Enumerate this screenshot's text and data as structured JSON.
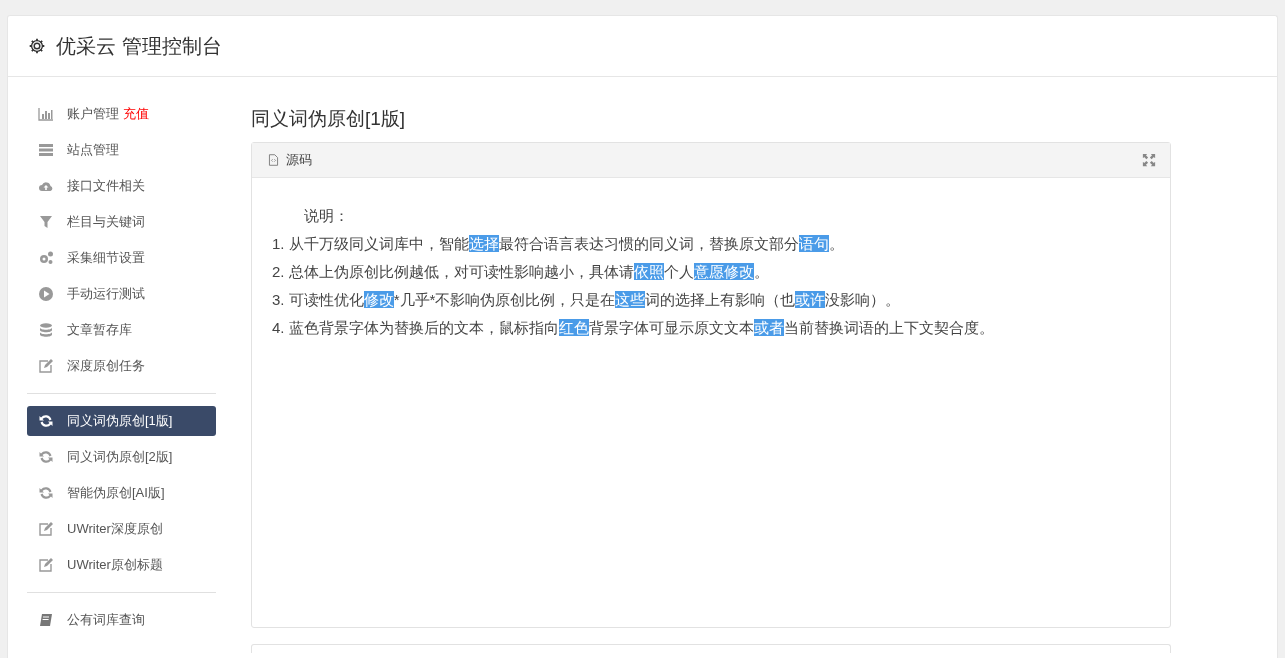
{
  "header": {
    "title": "优采云 管理控制台"
  },
  "sidebar": {
    "groups": [
      {
        "items": [
          {
            "kind": "chart",
            "label": "账户管理",
            "badge": "充值",
            "selected": false
          },
          {
            "kind": "server",
            "label": "站点管理",
            "selected": false
          },
          {
            "kind": "cloud",
            "label": "接口文件相关",
            "selected": false
          },
          {
            "kind": "filter",
            "label": "栏目与关键词",
            "selected": false
          },
          {
            "kind": "gears",
            "label": "采集细节设置",
            "selected": false
          },
          {
            "kind": "play",
            "label": "手动运行测试",
            "selected": false
          },
          {
            "kind": "database",
            "label": "文章暂存库",
            "selected": false
          },
          {
            "kind": "edit",
            "label": "深度原创任务",
            "selected": false
          }
        ]
      },
      {
        "items": [
          {
            "kind": "refresh",
            "label": "同义词伪原创[1版]",
            "selected": true
          },
          {
            "kind": "refresh",
            "label": "同义词伪原创[2版]",
            "selected": false
          },
          {
            "kind": "refresh",
            "label": "智能伪原创[AI版]",
            "selected": false
          },
          {
            "kind": "edit",
            "label": "UWriter深度原创",
            "selected": false
          },
          {
            "kind": "edit",
            "label": "UWriter原创标题",
            "selected": false
          }
        ]
      },
      {
        "items": [
          {
            "kind": "book",
            "label": "公有词库查询",
            "selected": false
          }
        ]
      }
    ]
  },
  "main": {
    "title": "同义词伪原创[1版]",
    "panel": {
      "title": "源码",
      "intro": "说明：",
      "lines": [
        [
          {
            "text": "1. 从千万级同义词库中，智能",
            "highlighted": false
          },
          {
            "text": "选择",
            "highlighted": true
          },
          {
            "text": "最符合语言表达习惯的同义词，替换原文部分",
            "highlighted": false
          },
          {
            "text": "语句",
            "highlighted": true
          },
          {
            "text": "。",
            "highlighted": false
          }
        ],
        [
          {
            "text": "2. 总体上伪原创比例越低，对可读性影响越小，具体请",
            "highlighted": false
          },
          {
            "text": "依照",
            "highlighted": true
          },
          {
            "text": "个人",
            "highlighted": false
          },
          {
            "text": "意愿",
            "highlighted": true
          },
          {
            "text": "修改",
            "highlighted": true
          },
          {
            "text": "。",
            "highlighted": false
          }
        ],
        [
          {
            "text": "3. 可读性优化",
            "highlighted": false
          },
          {
            "text": "修改",
            "highlighted": true
          },
          {
            "text": "*几乎*不影响伪原创比例，只是在",
            "highlighted": false
          },
          {
            "text": "这些",
            "highlighted": true
          },
          {
            "text": "词的选择上有影响（也",
            "highlighted": false
          },
          {
            "text": "或许",
            "highlighted": true
          },
          {
            "text": "没影响）。",
            "highlighted": false
          }
        ],
        [
          {
            "text": "4. 蓝色背景字体为替换后的文本，鼠标指向",
            "highlighted": false
          },
          {
            "text": "红色",
            "highlighted": true
          },
          {
            "text": "背景字体可显示原文文本",
            "highlighted": false
          },
          {
            "text": "或者",
            "highlighted": true
          },
          {
            "text": "当前替换词语的上下文契合度。",
            "highlighted": false
          }
        ]
      ]
    }
  }
}
